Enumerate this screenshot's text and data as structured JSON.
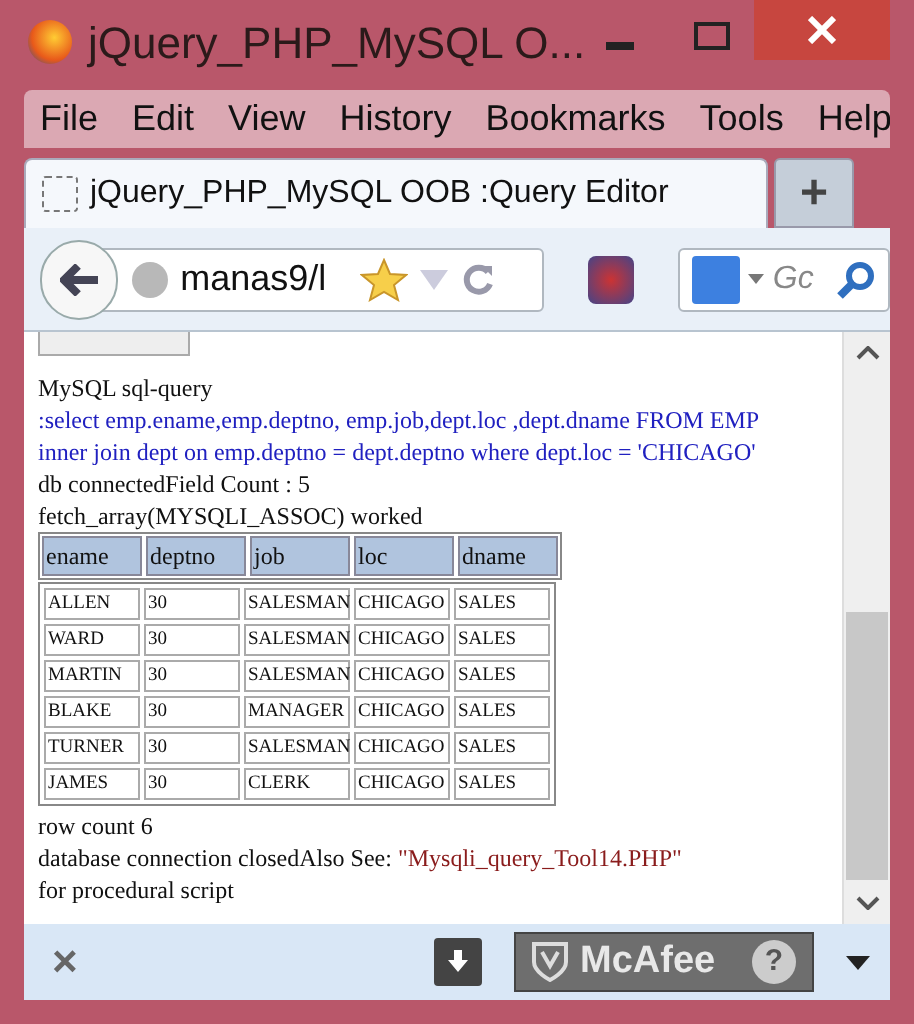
{
  "window": {
    "title": "jQuery_PHP_MySQL O..."
  },
  "menu": [
    "File",
    "Edit",
    "View",
    "History",
    "Bookmarks",
    "Tools",
    "Help"
  ],
  "tabs": [
    {
      "label": "jQuery_PHP_MySQL OOB :Query Editor",
      "selected": true
    }
  ],
  "new_tab": "+",
  "address": {
    "value": "manas9/l"
  },
  "search": {
    "placeholder": "Gc"
  },
  "content": {
    "heading": "MySQL sql-query",
    "query": ":select emp.ename,emp.deptno, emp.job,dept.loc ,dept.dname FROM EMP inner join dept on emp.deptno = dept.deptno where dept.loc = 'CHICAGO'",
    "status_lines": [
      "db connectedField Count : 5",
      "fetch_array(MYSQLI_ASSOC) worked"
    ],
    "table": {
      "columns": [
        "ename",
        "deptno",
        "job",
        "loc",
        "dname"
      ],
      "rows": [
        [
          "ALLEN",
          "30",
          "SALESMAN",
          "CHICAGO",
          "SALES"
        ],
        [
          "WARD",
          "30",
          "SALESMAN",
          "CHICAGO",
          "SALES"
        ],
        [
          "MARTIN",
          "30",
          "SALESMAN",
          "CHICAGO",
          "SALES"
        ],
        [
          "BLAKE",
          "30",
          "MANAGER",
          "CHICAGO",
          "SALES"
        ],
        [
          "TURNER",
          "30",
          "SALESMAN",
          "CHICAGO",
          "SALES"
        ],
        [
          "JAMES",
          "30",
          "CLERK",
          "CHICAGO",
          "SALES"
        ]
      ]
    },
    "row_count": "row count 6",
    "closing": "database connection closedAlso See: ",
    "see_also": "\"Mysqli_query_Tool14.PHP\"",
    "footer": "for procedural script"
  },
  "bottom_bar": {
    "close": "×",
    "brand": "McAfee",
    "help": "?"
  }
}
